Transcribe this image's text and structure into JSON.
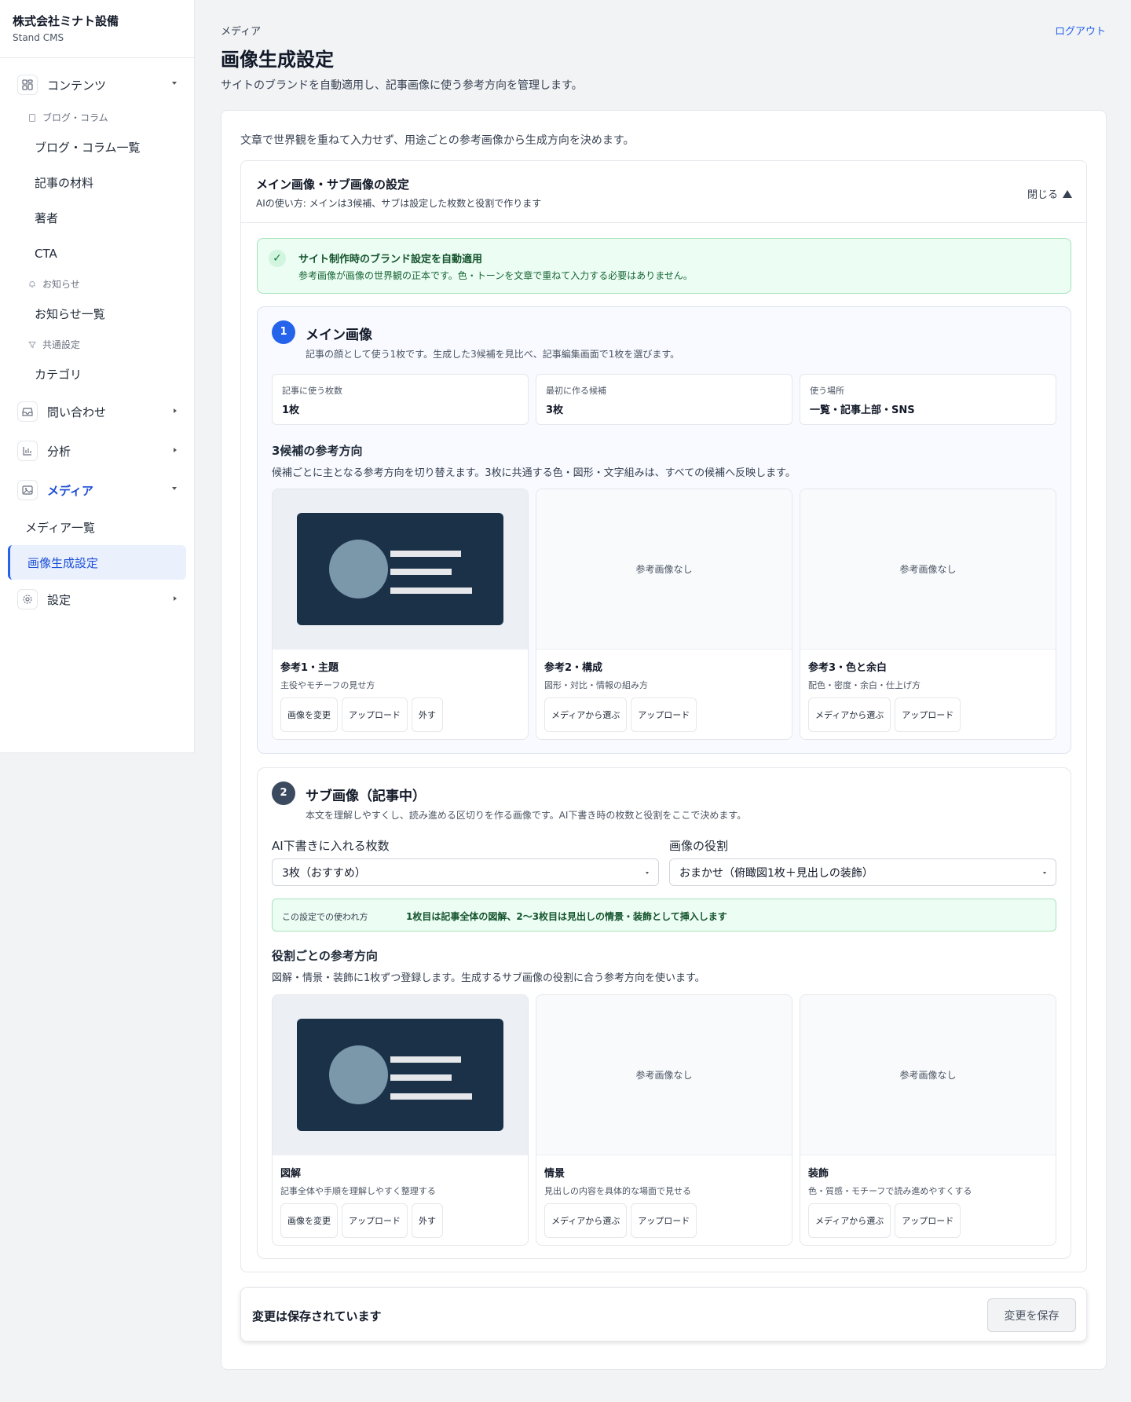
{
  "sidebar": {
    "company": "株式会社ミナト設備",
    "product": "Stand CMS",
    "groups": {
      "contents": "コンテンツ",
      "inquiry": "問い合わせ",
      "analytics": "分析",
      "media": "メディア",
      "settings": "設定"
    },
    "sub_headers": {
      "blog": "ブログ・コラム",
      "news": "お知らせ",
      "common": "共通設定"
    },
    "items": {
      "blog_list": "ブログ・コラム一覧",
      "materials": "記事の材料",
      "authors": "著者",
      "cta": "CTA",
      "news_list": "お知らせ一覧",
      "category": "カテゴリ",
      "media_list": "メディア一覧",
      "image_settings": "画像生成設定"
    }
  },
  "header": {
    "breadcrumb": "メディア",
    "logout": "ログアウト",
    "title": "画像生成設定",
    "description": "サイトのブランドを自動適用し、記事画像に使う参考方向を管理します。"
  },
  "card": {
    "intro": "文章で世界観を重ねて入力せず、用途ごとの参考画像から生成方向を決めます。"
  },
  "panel": {
    "title": "メイン画像・サブ画像の設定",
    "subtitle": "AIの使い方: メインは3候補、サブは設定した枚数と役割で作ります",
    "close_label": "閉じる"
  },
  "notice": {
    "title": "サイト制作時のブランド設定を自動適用",
    "body": "参考画像が画像の世界観の正本です。色・トーンを文章で重ねて入力する必要はありません。"
  },
  "main_image": {
    "number": "1",
    "title": "メイン画像",
    "subtitle": "記事の顔として使う1枚です。生成した3候補を見比べ、記事編集画面で1枚を選びます。",
    "stats": [
      {
        "label": "記事に使う枚数",
        "value": "1枚"
      },
      {
        "label": "最初に作る候補",
        "value": "3枚"
      },
      {
        "label": "使う場所",
        "value": "一覧・記事上部・SNS"
      }
    ],
    "refs_heading": "3候補の参考方向",
    "refs_desc": "候補ごとに主となる参考方向を切り替えます。3枚に共通する色・図形・文字組みは、すべての候補へ反映します。",
    "refs": [
      {
        "title": "参考1・主題",
        "desc": "主役やモチーフの見せ方",
        "buttons": [
          "画像を変更",
          "アップロード",
          "外す"
        ]
      },
      {
        "title": "参考2・構成",
        "desc": "図形・対比・情報の組み方",
        "placeholder": "参考画像なし",
        "buttons": [
          "メディアから選ぶ",
          "アップロード"
        ]
      },
      {
        "title": "参考3・色と余白",
        "desc": "配色・密度・余白・仕上げ方",
        "placeholder": "参考画像なし",
        "buttons": [
          "メディアから選ぶ",
          "アップロード"
        ]
      }
    ]
  },
  "sub_image": {
    "number": "2",
    "title": "サブ画像（記事中）",
    "subtitle": "本文を理解しやすくし、読み進める区切りを作る画像です。AI下書き時の枚数と役割をここで決めます。",
    "count_label": "AI下書きに入れる枚数",
    "count_value": "3枚（おすすめ）",
    "role_label": "画像の役割",
    "role_value": "おまかせ（俯瞰図1枚＋見出しの装飾）",
    "usage_label": "この設定での使われ方",
    "usage_text": "1枚目は記事全体の図解、2〜3枚目は見出しの情景・装飾として挿入します",
    "refs_heading": "役割ごとの参考方向",
    "refs_desc": "図解・情景・装飾に1枚ずつ登録します。生成するサブ画像の役割に合う参考方向を使います。",
    "refs": [
      {
        "title": "図解",
        "desc": "記事全体や手順を理解しやすく整理する",
        "buttons": [
          "画像を変更",
          "アップロード",
          "外す"
        ]
      },
      {
        "title": "情景",
        "desc": "見出しの内容を具体的な場面で見せる",
        "placeholder": "参考画像なし",
        "buttons": [
          "メディアから選ぶ",
          "アップロード"
        ]
      },
      {
        "title": "装飾",
        "desc": "色・質感・モチーフで読み進めやすくする",
        "placeholder": "参考画像なし",
        "buttons": [
          "メディアから選ぶ",
          "アップロード"
        ]
      }
    ]
  },
  "savebar": {
    "status": "変更は保存されています",
    "button": "変更を保存"
  },
  "colors": {
    "accent": "#2563eb",
    "thumb_bg": "#1b3148",
    "success_bg": "#ecfdf3"
  }
}
